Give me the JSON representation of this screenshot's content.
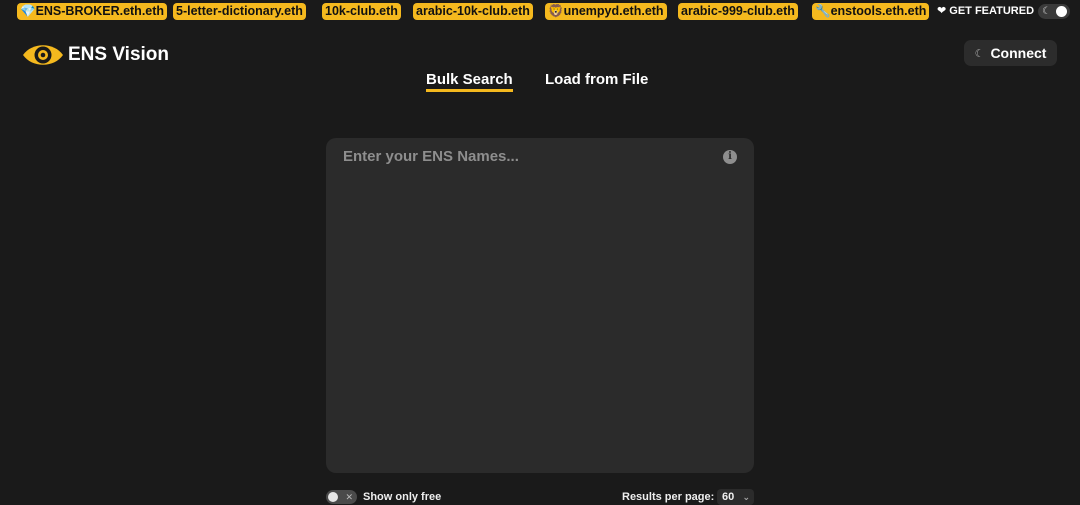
{
  "featured_bar": {
    "items": [
      "💎ENS-BROKER.eth.eth",
      "5-letter-dictionary.eth",
      "10k-club.eth",
      "arabic-10k-club.eth",
      "🦁unempyd.eth.eth",
      "arabic-999-club.eth",
      "🔧enstools.eth.eth"
    ],
    "get_featured_label": "❤ GET FEATURED",
    "accent_color": "#f5b91e"
  },
  "header": {
    "logo_text": "ENS Vision",
    "connect_label": "Connect"
  },
  "tabs": [
    {
      "label": "Bulk Search",
      "active": true
    },
    {
      "label": "Load from File",
      "active": false
    }
  ],
  "search": {
    "placeholder": "Enter your ENS Names...",
    "value": ""
  },
  "footer_controls": {
    "show_only_free_label": "Show only free",
    "show_only_free_enabled": false,
    "results_per_page_label": "Results per page:",
    "results_per_page_value": "60"
  }
}
